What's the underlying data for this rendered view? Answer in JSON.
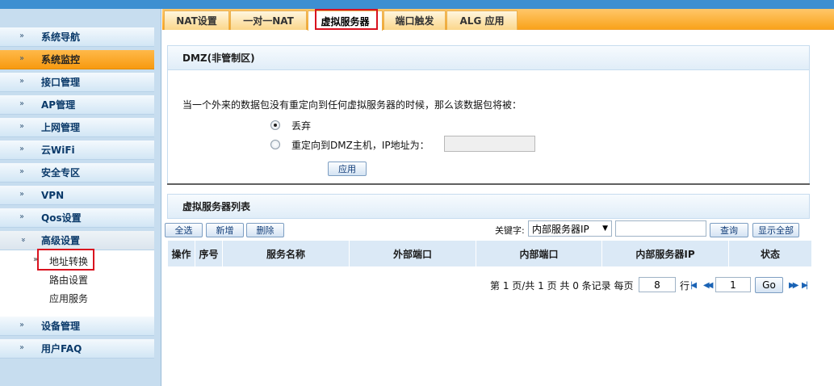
{
  "sidebar": {
    "items": [
      {
        "label": "系统导航",
        "state": "normal"
      },
      {
        "label": "系统监控",
        "state": "active"
      },
      {
        "label": "接口管理",
        "state": "normal"
      },
      {
        "label": "AP管理",
        "state": "normal"
      },
      {
        "label": "上网管理",
        "state": "normal"
      },
      {
        "label": "云WiFi",
        "state": "normal"
      },
      {
        "label": "安全专区",
        "state": "normal"
      },
      {
        "label": "VPN",
        "state": "normal"
      },
      {
        "label": "Qos设置",
        "state": "normal"
      },
      {
        "label": "高级设置",
        "state": "expanded"
      },
      {
        "label": "设备管理",
        "state": "normal"
      },
      {
        "label": "用户FAQ",
        "state": "normal"
      }
    ],
    "sub_items": [
      "地址转换",
      "路由设置",
      "应用服务"
    ],
    "selected_sub": "地址转换"
  },
  "tabs": [
    "NAT设置",
    "一对一NAT",
    "虚拟服务器",
    "端口触发",
    "ALG 应用"
  ],
  "active_tab": "虚拟服务器",
  "dmz": {
    "title": "DMZ(非管制区)",
    "description": "当一个外来的数据包没有重定向到任何虚拟服务器的时候，那么该数据包将被：",
    "option_drop": "丢弃",
    "option_redirect": "重定向到DMZ主机，IP地址为：",
    "selected_option": "丢弃",
    "ip_value": "",
    "apply_label": "应用"
  },
  "vserver": {
    "title": "虚拟服务器列表",
    "toolbar": {
      "select_all": "全选",
      "add": "新增",
      "delete": "删除"
    },
    "keyword_label": "关键字:",
    "keyword_option": "内部服务器IP",
    "keyword_value": "",
    "search_label": "查询",
    "show_all_label": "显示全部",
    "columns": [
      "操作",
      "序号",
      "服务名称",
      "外部端口",
      "内部端口",
      "内部服务器IP",
      "状态"
    ],
    "rows": []
  },
  "pager": {
    "summary": "第 1 页/共 1 页 共 0 条记录 每页",
    "per_page": "8",
    "rows_unit": "行",
    "page": "1",
    "go_label": "Go"
  }
}
